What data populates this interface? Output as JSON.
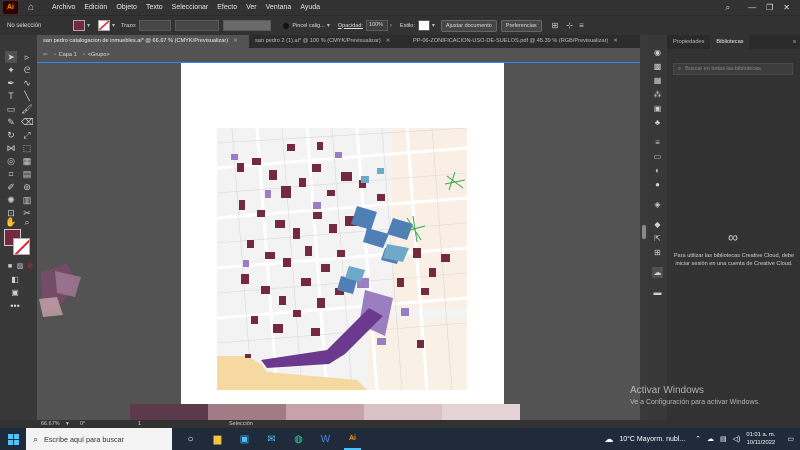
{
  "menubar": {
    "app_logo": "Ai",
    "items": [
      "Archivo",
      "Edición",
      "Objeto",
      "Texto",
      "Seleccionar",
      "Efecto",
      "Ver",
      "Ventana",
      "Ayuda"
    ]
  },
  "controlbar": {
    "selection_label": "No selección",
    "stroke_label": "Trazo:",
    "brush_label": "Pincel calig...",
    "opacity_label": "Opacidad:",
    "opacity_value": "100%",
    "style_label": "Estilo:",
    "adjust_doc_button": "Ajustar documento",
    "preferences_button": "Preferencias",
    "fill_color": "#74293e"
  },
  "tabs": [
    {
      "label": "san pedro catalogacion de inmuebles.ai* @ 66.67 % (CMYK/Previsualizar)",
      "active": true
    },
    {
      "label": "san pedro 2 (1).ai* @ 100 % (CMYK/Previsualizar)",
      "active": false
    },
    {
      "label": "PP-06-ZONIFICACION-USO-DE-SUELOS.pdf @ 45.39 % (RGB/Previsualizar)",
      "active": false
    }
  ],
  "breadcrumb": {
    "layer": "Capa 1",
    "group": "<Grupo>"
  },
  "panel": {
    "tabs": [
      "Propiedades",
      "Bibliotecas"
    ],
    "active_tab": "Bibliotecas",
    "search_placeholder": "Buscar en todas las bibliotecas",
    "message": "Para utilizar las bibliotecas Creative Cloud, debe iniciar sesión en una cuenta de Creative Cloud."
  },
  "watermark": {
    "line1": "Activar Windows",
    "line2": "Ve a Configuración para activar Windows."
  },
  "status": {
    "zoom": "66.67%",
    "rotation": "0°",
    "artboard": "1",
    "mode": "Selección"
  },
  "taskbar": {
    "search_placeholder": "Escribe aquí para buscar",
    "weather": "10°C  Mayorm. nubl...",
    "time": "01:01 a. m.",
    "date": "10/11/2022"
  },
  "colors": {
    "maroon": "#74293e",
    "purple": "#6b3a8e",
    "lavender": "#9b7ec0",
    "blue": "#4f7fb5",
    "light_blue": "#6fa9c9",
    "sand": "#f5d9a0",
    "mauve": "#c7a2ad"
  },
  "swatch_strip": [
    "#5d3a4b",
    "#a17b86",
    "#c7a2ad",
    "#d9c1c7",
    "#e4d2d6"
  ]
}
